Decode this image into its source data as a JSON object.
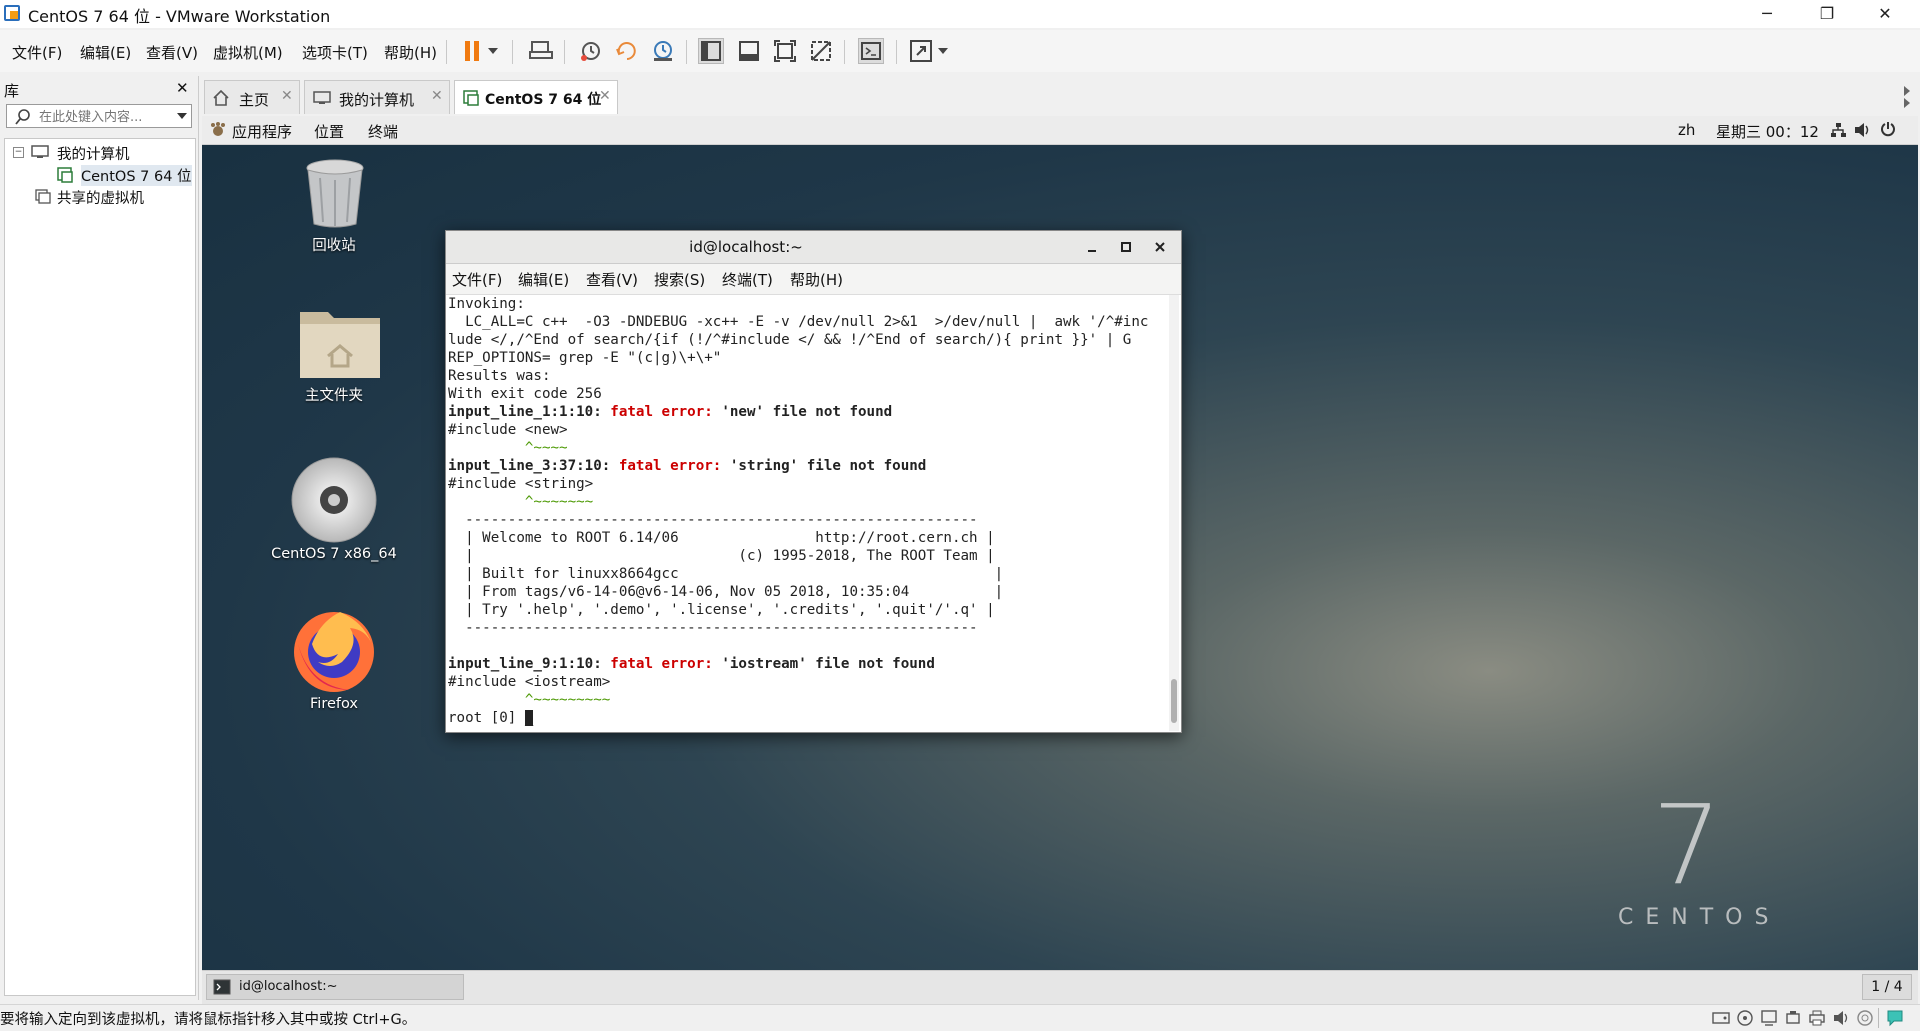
{
  "window": {
    "title": "CentOS 7 64 位 - VMware Workstation",
    "minimize": "─",
    "restore": "❐",
    "close": "✕"
  },
  "menu": [
    "文件(F)",
    "编辑(E)",
    "查看(V)",
    "虚拟机(M)",
    "选项卡(T)",
    "帮助(H)"
  ],
  "library": {
    "title": "库",
    "close": "✕",
    "search_placeholder": "在此处键入内容...",
    "tree": [
      "我的计算机",
      "CentOS 7 64 位",
      "共享的虚拟机"
    ]
  },
  "tabs": [
    {
      "label": "主页",
      "close": "✕"
    },
    {
      "label": "我的计算机",
      "close": "✕"
    },
    {
      "label": "CentOS 7 64 位",
      "close": "✕"
    }
  ],
  "gnome": {
    "apps": "应用程序",
    "places": "位置",
    "terminal": "终端",
    "lang": "zh",
    "clock": "星期三 00：12"
  },
  "desktop": {
    "icons": [
      "回收站",
      "主文件夹",
      "CentOS 7 x86_64",
      "Firefox"
    ],
    "brand_number": "7",
    "brand_word": "CENTOS"
  },
  "terminal": {
    "title": "id@localhost:~",
    "menu": [
      "文件(F)",
      "编辑(E)",
      "查看(V)",
      "搜索(S)",
      "终端(T)",
      "帮助(H)"
    ],
    "lines": {
      "l1": "Invoking:",
      "l2": "  LC_ALL=C c++  -O3 -DNDEBUG -xc++ -E -v /dev/null 2>&1  >/dev/null |  awk '/^#inc",
      "l3": "lude </,/^End of search/{if (!/^#include </ && !/^End of search/){ print }}' | G",
      "l4": "REP_OPTIONS= grep -E \"(c|g)\\+\\+\"",
      "l5": "Results was:",
      "l6": "With exit code 256",
      "e1a": "input_line_1:1:10: ",
      "e1b": "fatal error: ",
      "e1c": "'new' file not found",
      "i1": "#include <new>",
      "u1": "         ^~~~~",
      "e2a": "input_line_3:37:10: ",
      "e2b": "fatal error: ",
      "e2c": "'string' file not found",
      "i2": "#include <string>",
      "u2": "         ^~~~~~~~",
      "box1": "  ------------------------------------------------------------",
      "box2": "  | Welcome to ROOT 6.14/06                http://root.cern.ch |",
      "box3": "  |                               (c) 1995-2018, The ROOT Team |",
      "box4": "  | Built for linuxx8664gcc                                     |",
      "box5": "  | From tags/v6-14-06@v6-14-06, Nov 05 2018, 10:35:04          |",
      "box6": "  | Try '.help', '.demo', '.license', '.credits', '.quit'/'.q' |",
      "box7": "  ------------------------------------------------------------",
      "e3a": "input_line_9:1:10: ",
      "e3b": "fatal error: ",
      "e3c": "'iostream' file not found",
      "i3": "#include <iostream>",
      "u3": "         ^~~~~~~~~~",
      "prompt": "root [0] "
    }
  },
  "taskbar": {
    "item": "id@localhost:~",
    "pages": "1 / 4"
  },
  "status": {
    "message": "要将输入定向到该虚拟机，请将鼠标指针移入其中或按 Ctrl+G。"
  }
}
